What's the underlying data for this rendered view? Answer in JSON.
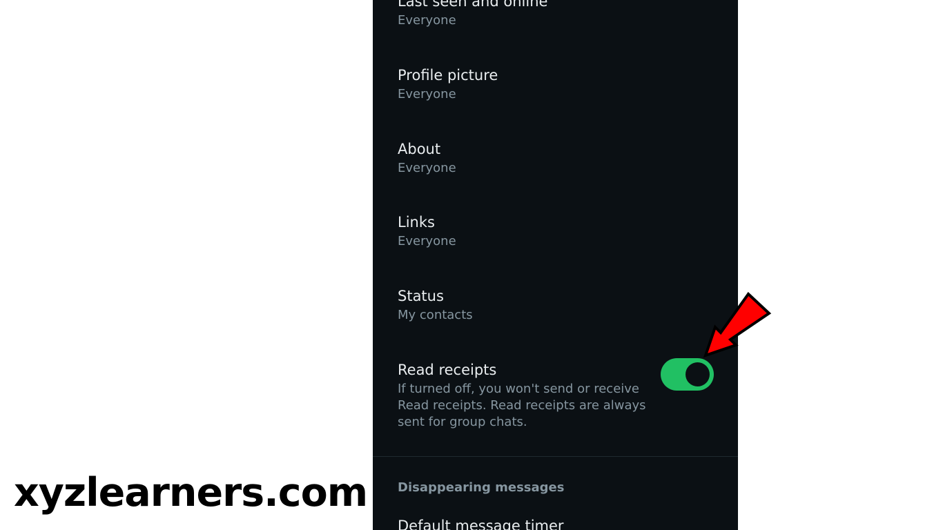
{
  "settings": {
    "items": [
      {
        "title": "Last seen and online",
        "value": "Everyone"
      },
      {
        "title": "Profile picture",
        "value": "Everyone"
      },
      {
        "title": "About",
        "value": "Everyone"
      },
      {
        "title": "Links",
        "value": "Everyone"
      },
      {
        "title": "Status",
        "value": "My contacts"
      }
    ],
    "read_receipts": {
      "title": "Read receipts",
      "description": "If turned off, you won't send or receive Read receipts. Read receipts are always sent for group chats.",
      "enabled": true
    },
    "disappearing_section": {
      "header": "Disappearing messages",
      "first_item": "Default message timer"
    }
  },
  "annotation": {
    "arrow_icon": "red-arrow-icon",
    "arrow_color": "#ff0000"
  },
  "watermark": {
    "text": "xyzlearners.com"
  },
  "colors": {
    "background": "#0b1014",
    "primary_text": "#e9edef",
    "secondary_text": "#8696a0",
    "toggle_on": "#21c063"
  }
}
